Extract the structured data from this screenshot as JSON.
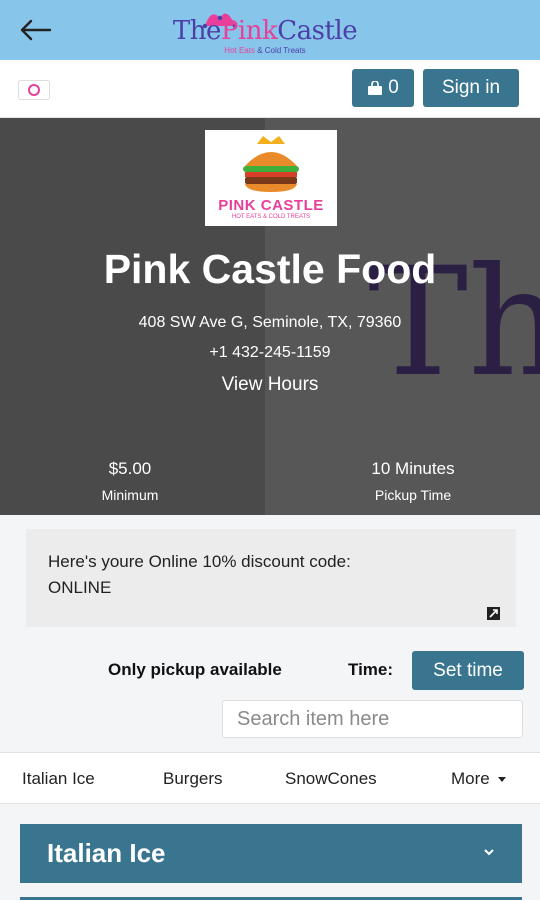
{
  "topbar": {
    "brand_title_a": "The",
    "brand_title_b": "Pink",
    "brand_title_c": "Castle",
    "brand_sub_a": "Hot Eats",
    "brand_sub_b": "& Cold Treats"
  },
  "actionbar": {
    "cart_count": "0",
    "signin_label": "Sign in"
  },
  "hero": {
    "logo_text": "PINK CASTLE",
    "logo_sub": "HOT EATS & COLD TREATS",
    "store_name": "Pink Castle Food",
    "address": "408 SW Ave G, Seminole, TX, 79360",
    "phone": "+1 432-245-1159",
    "view_hours": "View Hours",
    "bg_text": "Th",
    "minimum_value": "$5.00",
    "minimum_label": "Minimum",
    "pickup_value": "10 Minutes",
    "pickup_label": "Pickup Time"
  },
  "promo": {
    "line1": "Here's youre Online 10% discount code:",
    "line2": "ONLINE"
  },
  "order": {
    "pickup_only": "Only pickup available",
    "time_label": "Time:",
    "set_time_label": "Set time"
  },
  "search": {
    "placeholder": "Search item here"
  },
  "categories": [
    "Italian Ice",
    "Burgers",
    "SnowCones",
    "More"
  ],
  "section": {
    "title": "Italian Ice"
  },
  "colors": {
    "topbar": "#87c6ea",
    "accent": "#3a7590",
    "brand_pink": "#e8409a",
    "brand_purple": "#4b3fa8"
  }
}
